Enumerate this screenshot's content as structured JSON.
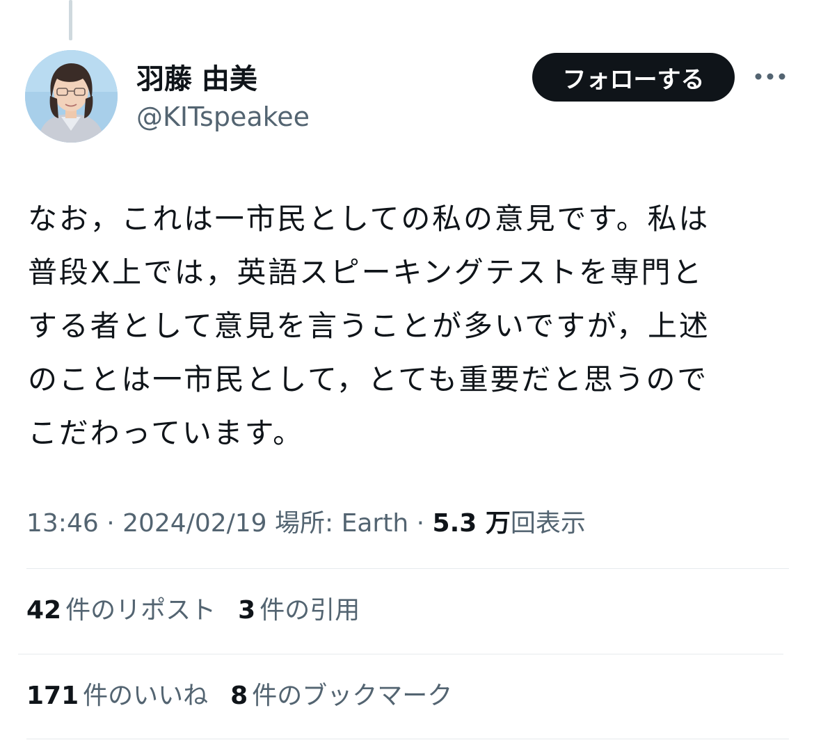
{
  "colors": {
    "text_primary": "#0f1419",
    "text_secondary": "#536471",
    "follow_bg": "#0f1419",
    "follow_text": "#ffffff",
    "divider": "#e6eaed",
    "thread_line": "#cfd9de"
  },
  "author": {
    "display_name": "羽藤 由美",
    "handle": "@KITspeakee",
    "avatar_icon": "user-avatar-photo"
  },
  "actions": {
    "follow_label": "フォローする",
    "more_icon": "more-horizontal-icon"
  },
  "tweet": {
    "lines": [
      "なお，これは一市民としての私の意見です。私は",
      "普段X上では，英語スピーキングテストを専門と",
      "する者として意見を言うことが多いですが，上述",
      "のことは一市民として，とても重要だと思うので",
      "こだわっています。"
    ]
  },
  "meta": {
    "time": "13:46",
    "separator": " · ",
    "date": "2024/02/19",
    "location": "場所: Earth",
    "views_count": "5.3 万",
    "views_label": "回表示"
  },
  "stats": {
    "reposts_count": "42",
    "reposts_label": "件のリポスト",
    "quotes_count": "3",
    "quotes_label": "件の引用",
    "likes_count": "171",
    "likes_label": "件のいいね",
    "bookmarks_count": "8",
    "bookmarks_label": "件のブックマーク"
  }
}
